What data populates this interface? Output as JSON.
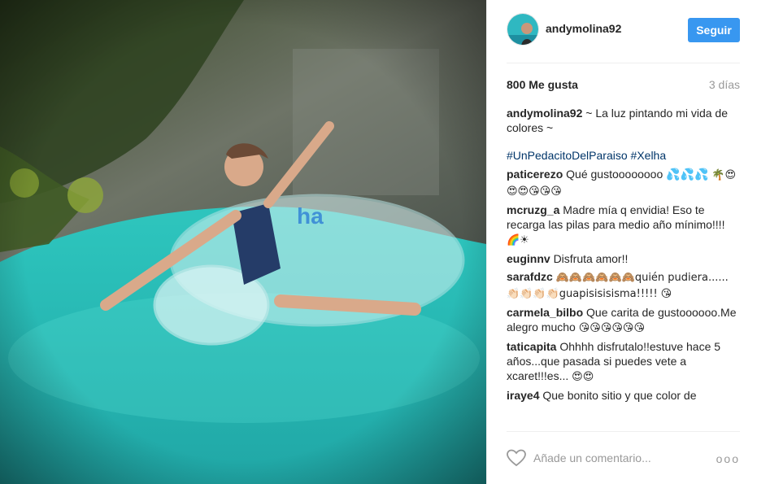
{
  "post": {
    "username": "andymolina92",
    "follow_label": "Seguir",
    "likes": "800 Me gusta",
    "time": "3 días"
  },
  "caption": {
    "user": "andymolina92",
    "text": "~ La luz pintando mi vida de colores ~",
    "hashtags": "#UnPedacitoDelParaiso #Xelha"
  },
  "comments": [
    {
      "user": "paticerezo",
      "text": "Qué gustoooooooo 💦💦💦",
      "emoji": "🌴😍😍😍😘😘😘"
    },
    {
      "user": "mcruzg_a",
      "text": "Madre mía q envidia! Eso te recarga las pilas para medio año mínimo!!!!",
      "emoji": "🌈☀"
    },
    {
      "user": "euginnv",
      "text": "Disfruta amor!!",
      "emoji": ""
    },
    {
      "user": "sarafdzc",
      "text": "🙈🙈🙈🙈🙈🙈quién pudiera......👏🏻👏🏻👏🏻👏🏻guapisisisisma!!!!!",
      "emoji": "😘"
    },
    {
      "user": "carmela_bilbo",
      "text": "Que carita de gustoooooo.Me alegro mucho",
      "emoji": "😘😘😘😘😘😘"
    },
    {
      "user": "taticapita",
      "text": "Ohhhh disfrutalo!!estuve hace 5 años...que pasada si puedes vete a xcaret!!!es...",
      "emoji": "😍😍"
    },
    {
      "user": "iraye4",
      "text": "Que bonito sitio y que color de",
      "emoji": ""
    }
  ],
  "footer": {
    "heart_icon": "heart-icon",
    "comment_placeholder": "Añade un comentario...",
    "more_icon": "more-options-icon",
    "more_label": "ooo"
  },
  "colors": {
    "accent": "#3897f0",
    "hashtag": "#003569",
    "water": "#2fc0bb"
  }
}
